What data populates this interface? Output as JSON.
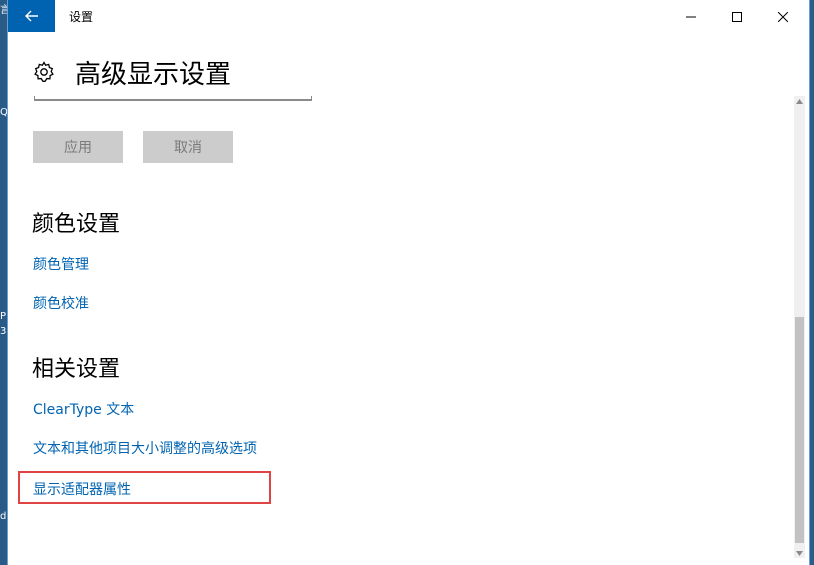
{
  "window": {
    "title": "设置",
    "controls": {
      "minimize": "minimize",
      "maximize": "maximize",
      "close": "close"
    }
  },
  "page": {
    "title": "高级显示设置"
  },
  "actions": {
    "apply_label": "应用",
    "cancel_label": "取消"
  },
  "color_settings": {
    "heading": "颜色设置",
    "links": [
      "颜色管理",
      "颜色校准"
    ]
  },
  "related_settings": {
    "heading": "相关设置",
    "links": [
      "ClearType 文本",
      "文本和其他项目大小调整的高级选项",
      "显示适配器属性"
    ]
  },
  "desktop_fragments": [
    "言",
    "Q",
    "P",
    "3",
    "d"
  ],
  "colors": {
    "accent": "#0063b1",
    "back_button_bg": "#0063b1",
    "disabled_button_bg": "#cccccc",
    "highlight_box": "#e04343"
  },
  "icons": {
    "back": "back-arrow-icon",
    "gear": "gear-icon",
    "minimize": "minimize-icon",
    "maximize": "maximize-icon",
    "close": "close-icon"
  }
}
